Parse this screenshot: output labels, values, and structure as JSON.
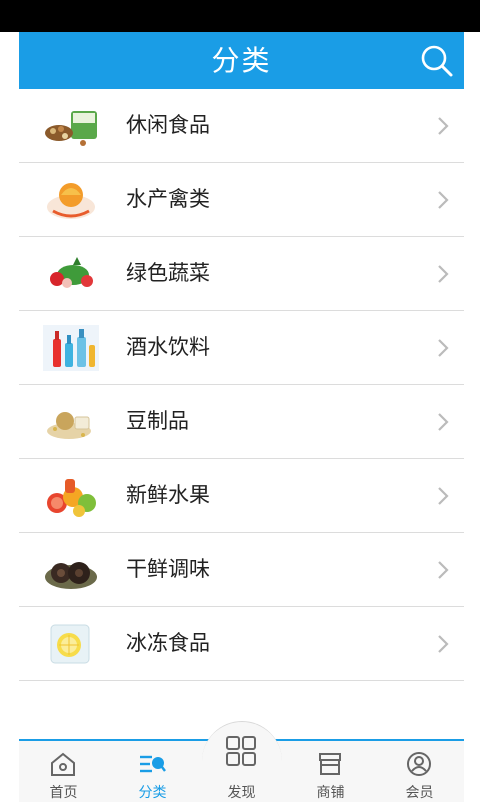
{
  "header": {
    "title": "分类"
  },
  "categories": [
    {
      "label": "休闲食品"
    },
    {
      "label": "水产禽类"
    },
    {
      "label": "绿色蔬菜"
    },
    {
      "label": "酒水饮料"
    },
    {
      "label": "豆制品"
    },
    {
      "label": "新鲜水果"
    },
    {
      "label": "干鲜调味"
    },
    {
      "label": "冰冻食品"
    }
  ],
  "tabbar": {
    "home": "首页",
    "category": "分类",
    "discover": "发现",
    "shops": "商铺",
    "member": "会员"
  },
  "colors": {
    "accent": "#1a9de6",
    "status_bar": "#000000"
  }
}
